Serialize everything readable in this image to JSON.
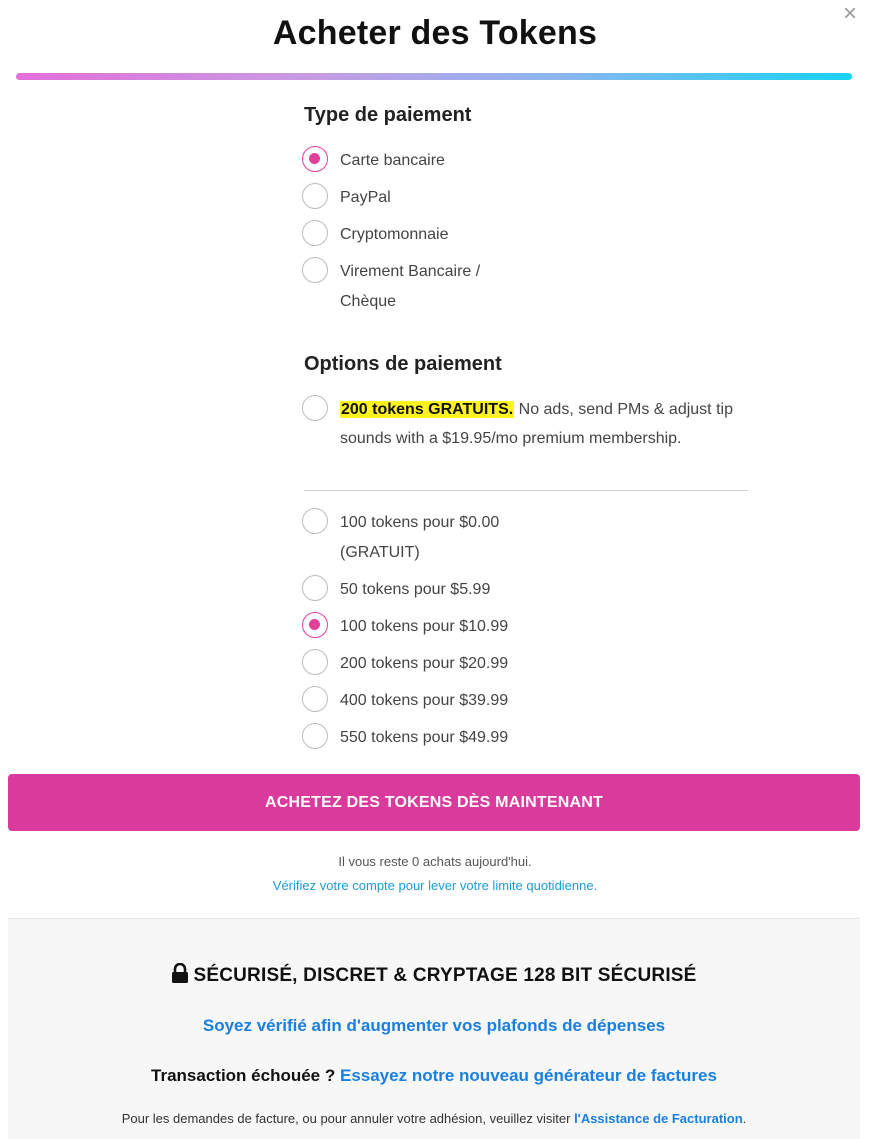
{
  "modal": {
    "title": "Acheter des Tokens",
    "close_glyph": "×"
  },
  "payment_type": {
    "title": "Type de paiement",
    "options": [
      {
        "label": "Carte bancaire",
        "checked": true
      },
      {
        "label": "PayPal",
        "checked": false
      },
      {
        "label": "Cryptomonnaie",
        "checked": false
      },
      {
        "label": "Virement Bancaire /",
        "label2": "Chèque",
        "checked": false
      }
    ]
  },
  "payment_options": {
    "title": "Options de paiement",
    "promo": {
      "highlight": "200 tokens GRATUITS.",
      "text": " No ads, send PMs & adjust tip sounds with a $19.95/mo premium membership."
    },
    "packages": [
      {
        "label": "100 tokens pour $0.00",
        "label2": "(GRATUIT)",
        "checked": false
      },
      {
        "label": "50 tokens pour $5.99",
        "checked": false
      },
      {
        "label": "100 tokens pour $10.99",
        "checked": true
      },
      {
        "label": "200 tokens pour $20.99",
        "checked": false
      },
      {
        "label": "400 tokens pour $39.99",
        "checked": false
      },
      {
        "label": "550 tokens pour $49.99",
        "checked": false
      }
    ]
  },
  "buy_button": "ACHETEZ DES TOKENS DÈS MAINTENANT",
  "remaining_text": "Il vous reste 0 achats aujourd'hui.",
  "verify_limit_link": "Vérifiez votre compte pour lever votre limite quotidienne.",
  "footer": {
    "secure_text": "SÉCURISÉ, DISCRET & CRYPTAGE 128 BIT SÉCURISÉ",
    "verify_spend_link": "Soyez vérifié afin d'augmenter vos plafonds de dépenses",
    "failed_text": "Transaction échouée ?",
    "invoice_link": "Essayez notre nouveau générateur de factures",
    "billing_text": "Pour les demandes de facture, ou pour annuler votre adhésion, veuillez visiter",
    "billing_link": "l'Assistance de Facturation",
    "billing_end": "."
  },
  "colors": {
    "accent": "#e0409a",
    "button": "#d93a9c",
    "link": "#1a7fe0",
    "highlight": "#fff51c"
  },
  "icons": [
    "close-icon",
    "lock-icon",
    "radio-icon"
  ]
}
